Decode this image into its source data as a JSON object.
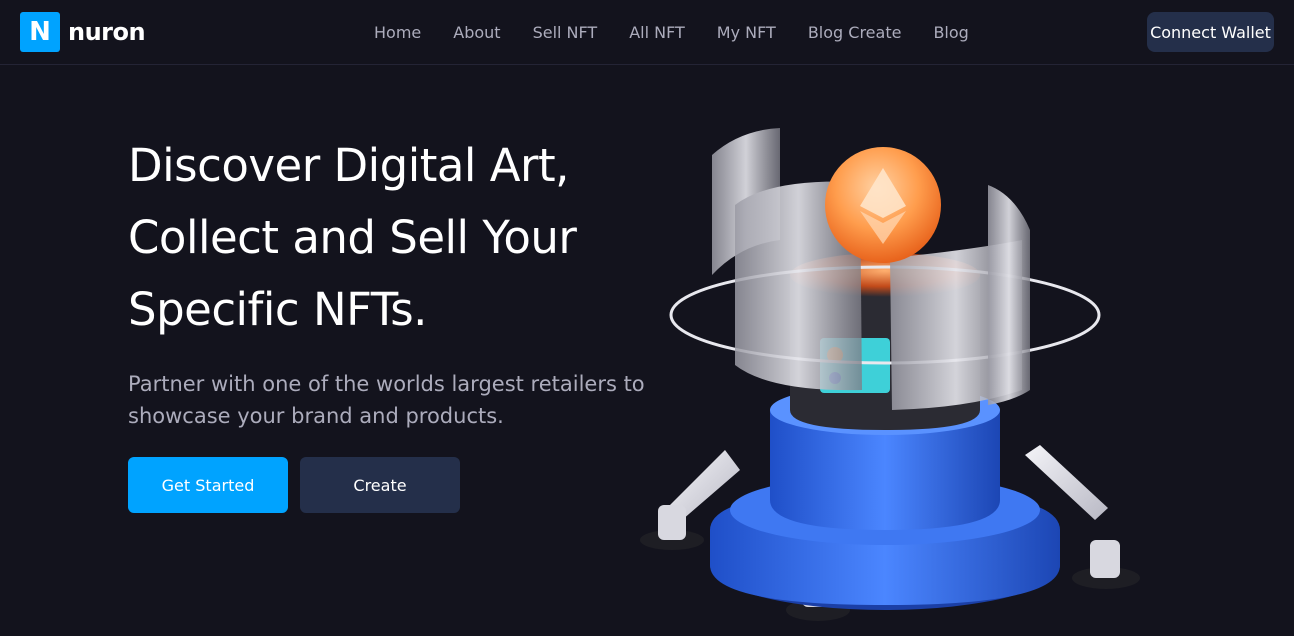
{
  "brand": {
    "badge_letter": "N",
    "name": "nuron",
    "accent_color": "#00a3ff"
  },
  "nav": {
    "items": [
      {
        "label": "Home"
      },
      {
        "label": "About"
      },
      {
        "label": "Sell NFT"
      },
      {
        "label": "All NFT"
      },
      {
        "label": "My NFT"
      },
      {
        "label": "Blog Create"
      },
      {
        "label": "Blog"
      }
    ]
  },
  "header": {
    "connect_label": "Connect Wallet"
  },
  "hero": {
    "title_lines": [
      "Discover Digital Art,",
      "Collect and Sell Your",
      "Specific NFTs."
    ],
    "description": "Partner with one of the worlds largest retailers to showcase your brand and products.",
    "primary_label": "Get Started",
    "secondary_label": "Create",
    "illustration": "nft-robot-illustration"
  },
  "colors": {
    "background": "#13131d",
    "button_dark": "#242f4a",
    "muted_text": "#acacbc"
  }
}
